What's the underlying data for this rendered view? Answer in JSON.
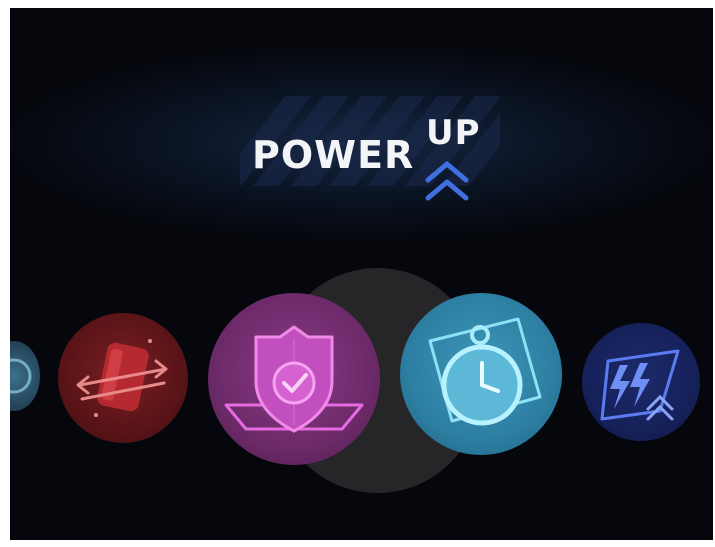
{
  "title": {
    "word1": "POWER",
    "word2": "UP"
  },
  "icons": {
    "edge": "partial-icon",
    "left": "jersey-swap-icon",
    "selected": "shield-check-icon",
    "right": "stopwatch-icon",
    "far_right": "lightning-boost-icon"
  },
  "colors": {
    "background": "#05070d",
    "title_text": "#f2f4f8",
    "chevron_accent": "#3f6fe0",
    "red_icon": "#c44a4a",
    "shield_icon": "#e46be0",
    "watch_icon": "#8fe0f5",
    "bolt_icon": "#5a7cf0"
  }
}
